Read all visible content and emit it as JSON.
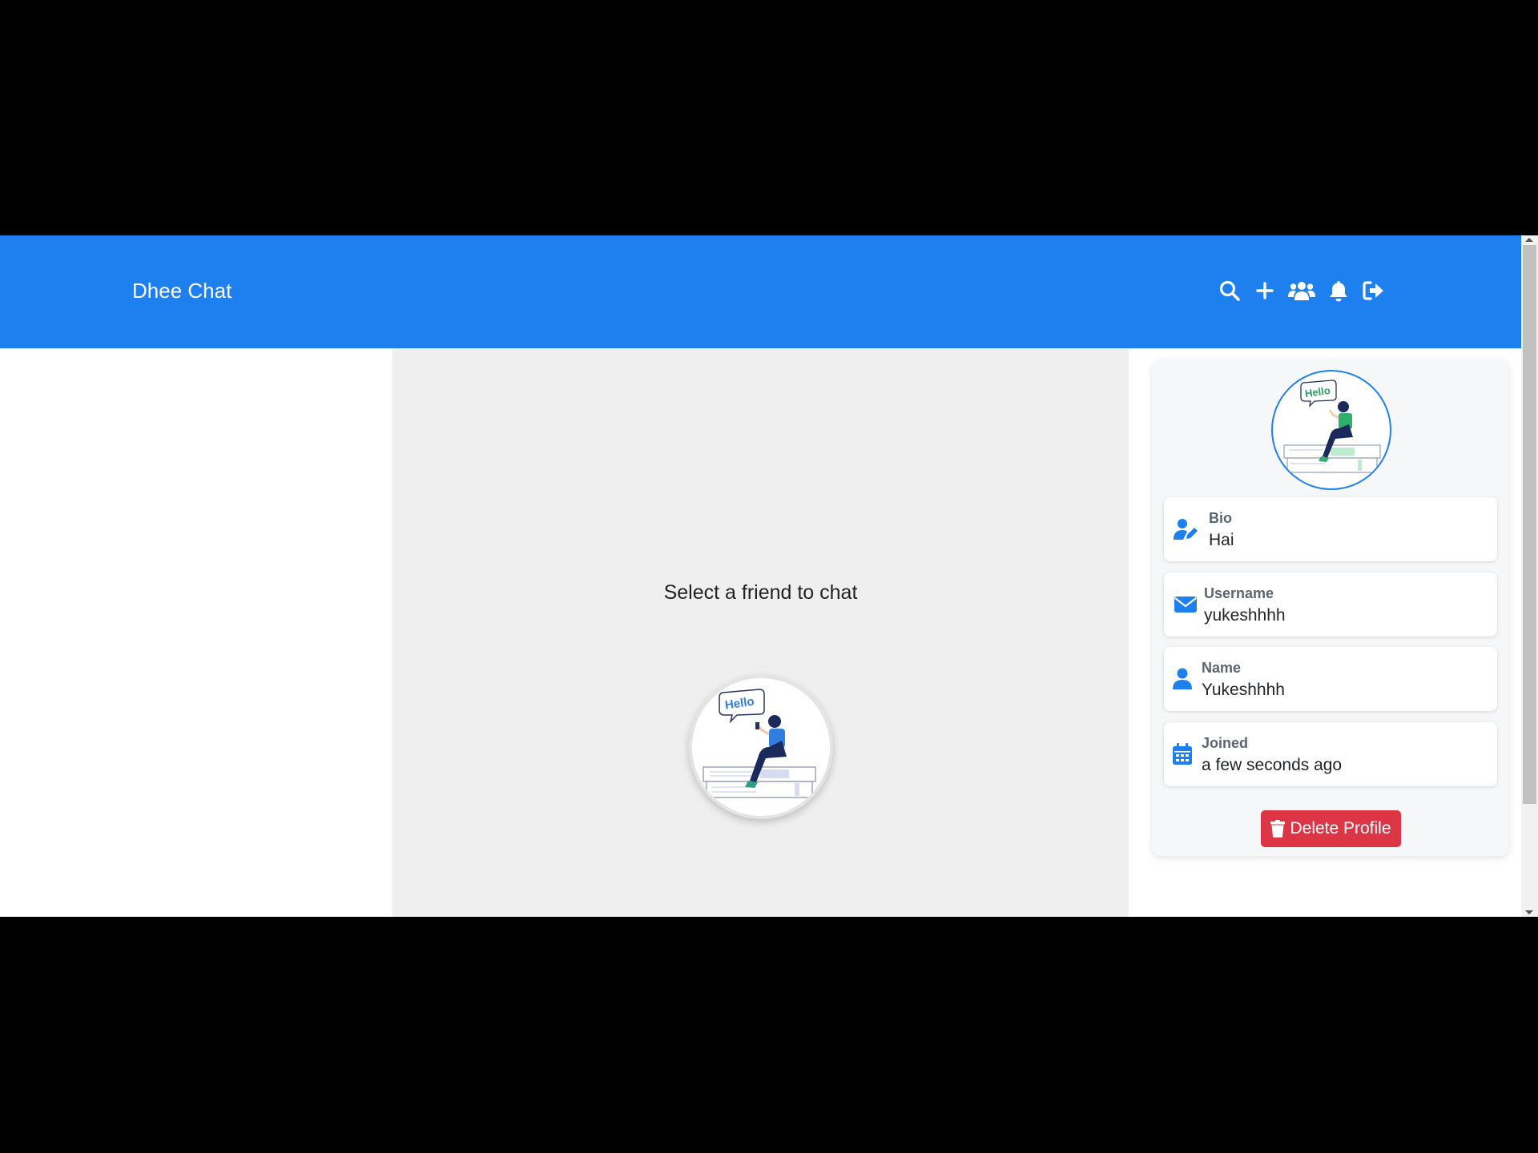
{
  "navbar": {
    "brand": "Dhee Chat",
    "icons": [
      "search-icon",
      "plus-icon",
      "users-icon",
      "bell-icon",
      "logout-icon"
    ]
  },
  "chat": {
    "placeholder": "Select a friend to chat",
    "illustration_text": "Hello"
  },
  "profile": {
    "avatar_text": "Hello",
    "fields": [
      {
        "label": "Bio",
        "value": "Hai",
        "icon": "user-edit-icon"
      },
      {
        "label": "Username",
        "value": "yukeshhhh",
        "icon": "envelope-icon"
      },
      {
        "label": "Name",
        "value": "Yukeshhhh",
        "icon": "user-icon"
      },
      {
        "label": "Joined",
        "value": "a few seconds ago",
        "icon": "calendar-icon"
      }
    ],
    "delete_label": "Delete Profile"
  },
  "colors": {
    "primary": "#1e7fef",
    "danger": "#dc3545",
    "chat_bg": "#efefef"
  }
}
